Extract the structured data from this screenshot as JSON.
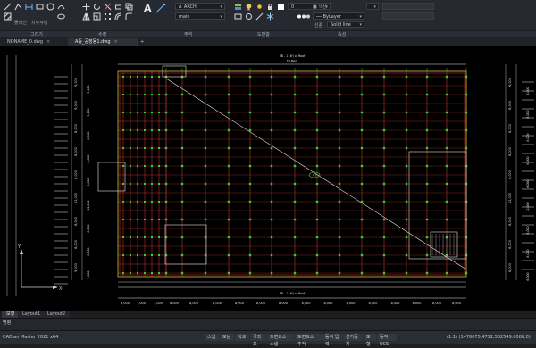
{
  "ribbon": {
    "groups": [
      {
        "label": "그리기"
      },
      {
        "label": "수정"
      },
      {
        "label": "주석"
      },
      {
        "label": "도면층"
      },
      {
        "label": "속성"
      }
    ],
    "draw_labels": {
      "polyline": "폴리선",
      "dimension": "치수작성"
    },
    "text_style": "A_ARCH",
    "dim_style": "main",
    "layer_value": "0",
    "color_value": "ByLayer",
    "linetype_label": "선종",
    "linetype_value": "Solid line",
    "lineweight_label": "선두께",
    "lineweight_value": "ByLayer",
    "color_label": "색상"
  },
  "tabs": [
    {
      "label": "NONAME_0.dwg"
    },
    {
      "label": "A동_공장동1.dwg"
    }
  ],
  "tab_add": "+",
  "tab_close": "×",
  "layout_tabs": [
    {
      "label": "모형"
    },
    {
      "label": "Layout1"
    },
    {
      "label": "Layout2"
    }
  ],
  "command_line": "명령 :",
  "app_title": "CADian Master 2021 x64",
  "status_buttons": [
    "스냅",
    "모눈",
    "직교",
    "극좌표",
    "도면요소 스냅",
    "도면요소 추적",
    "동적 입력",
    "선가중치",
    "모형",
    "동적 UCS"
  ],
  "coordinates": "(1:1) (1476075.4712,562549.0088,0)",
  "drawing": {
    "title_top": "TB - 1 (4f) or Roof",
    "title_sub": "TB-Mark",
    "title_bottom": "TB - 1 (4f) or Roof",
    "center_tag": "A1",
    "bottom_dims": [
      "5,000",
      "7,000",
      "7,000",
      "8,000",
      "8,000",
      "8,000",
      "8,000",
      "8,000",
      "8,000",
      "8,000",
      "8,000",
      "8,000",
      "8,000",
      "8,000",
      "8,000",
      "8,000",
      "8,000"
    ],
    "left_dims": [
      "9,000",
      "9,000",
      "8,000",
      "8,000",
      "8,000",
      "12,000",
      "8,000",
      "8,000",
      "9,000"
    ],
    "right_dims": [
      "6,000",
      "8,000",
      "8,000",
      "8,000",
      "6,000",
      "12,000",
      "8,000",
      "8,000",
      "6,000"
    ],
    "axis_y": "Y",
    "axis_x": "X"
  }
}
